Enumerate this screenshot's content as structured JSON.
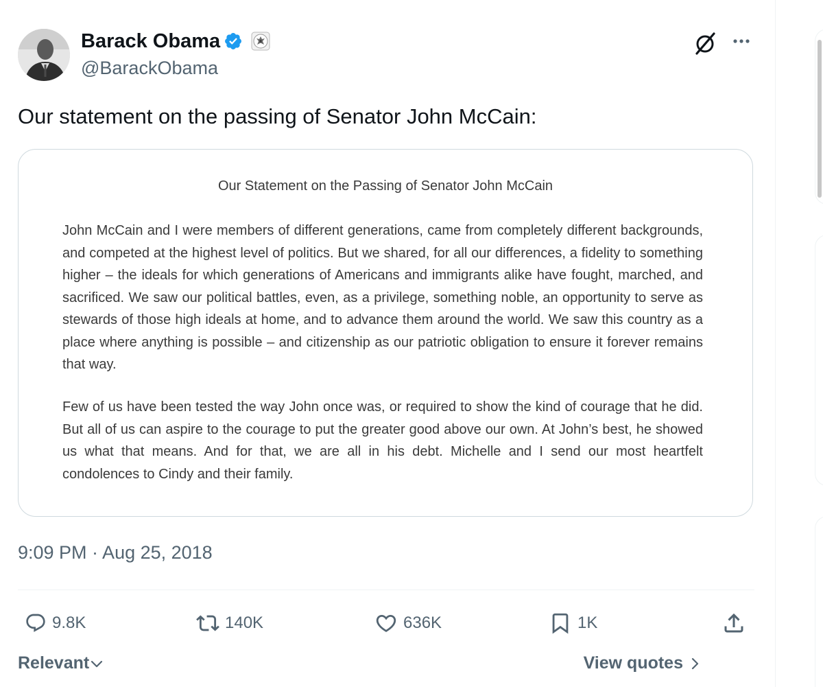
{
  "author": {
    "display_name": "Barack Obama",
    "handle": "@BarackObama",
    "verified_color": "#1d9bf0"
  },
  "icons": {
    "verified": "verified-badge-icon",
    "affiliation": "government-seal-icon",
    "grok": "grok-icon",
    "more": "more-icon"
  },
  "tweet": {
    "text": "Our statement on the passing of Senator John McCain:",
    "timestamp": "9:09 PM · Aug 25, 2018"
  },
  "statement": {
    "title": "Our Statement on the Passing of Senator John McCain",
    "paragraph1": "John McCain and I were members of different generations, came from completely different backgrounds, and competed at the highest level of politics. But we shared, for all our differences, a fidelity to something higher – the ideals for which generations of Americans and immigrants alike have fought, marched, and sacrificed. We saw our political battles, even, as a privilege, something noble, an opportunity to serve as stewards of those high ideals at home, and to advance them around the world. We saw this country as a place where anything is possible – and citizenship as our patriotic obligation to ensure it forever remains that way.",
    "paragraph2": "Few of us have been tested the way John once was, or required to show the kind of courage that he did. But all of us can aspire to the courage to put the greater good above our own. At John’s best, he showed us what that means. And for that, we are all in his debt. Michelle and I send our most heartfelt condolences to Cindy and their family."
  },
  "actions": {
    "replies": "9.8K",
    "reposts": "140K",
    "likes": "636K",
    "bookmarks": "1K"
  },
  "footer": {
    "sort_label": "Relevant",
    "view_quotes_label": "View quotes"
  }
}
